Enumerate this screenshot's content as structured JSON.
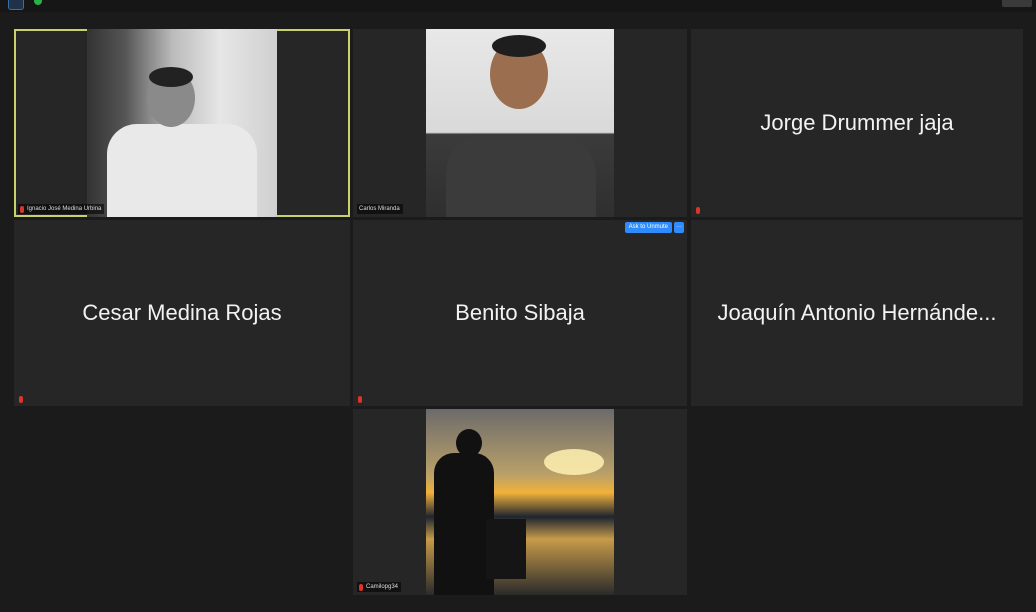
{
  "participants": [
    {
      "name": "Ignacio José Medina Urbina",
      "has_video": true,
      "muted": true,
      "active_speaker": true
    },
    {
      "name": "Carlos Miranda",
      "has_video": true,
      "muted": false,
      "active_speaker": false
    },
    {
      "name": "Jorge Drummer jaja",
      "has_video": false,
      "muted": true,
      "active_speaker": false
    },
    {
      "name": "Cesar Medina Rojas",
      "has_video": false,
      "muted": true,
      "active_speaker": false
    },
    {
      "name": "Benito Sibaja",
      "has_video": false,
      "muted": true,
      "active_speaker": false,
      "hover_actions": {
        "ask_to_unmute": "Ask to Unmute",
        "more": "···"
      }
    },
    {
      "name": "Joaquín Antonio Hernánde...",
      "has_video": false,
      "muted": false,
      "active_speaker": false
    },
    {
      "name": "Camilopg34",
      "has_video": true,
      "muted": true,
      "active_speaker": false
    }
  ],
  "colors": {
    "background": "#1b1b1b",
    "tile": "#262626",
    "active_border": "#c9d26a",
    "muted_mic": "#d9352b",
    "accent_button": "#2d8cff",
    "name_text": "#f2f2f2"
  },
  "icons": {
    "muted": "mic-muted-icon",
    "top_left": "security-icon",
    "top_status": "connection-status-icon",
    "top_right": "view-icon"
  }
}
